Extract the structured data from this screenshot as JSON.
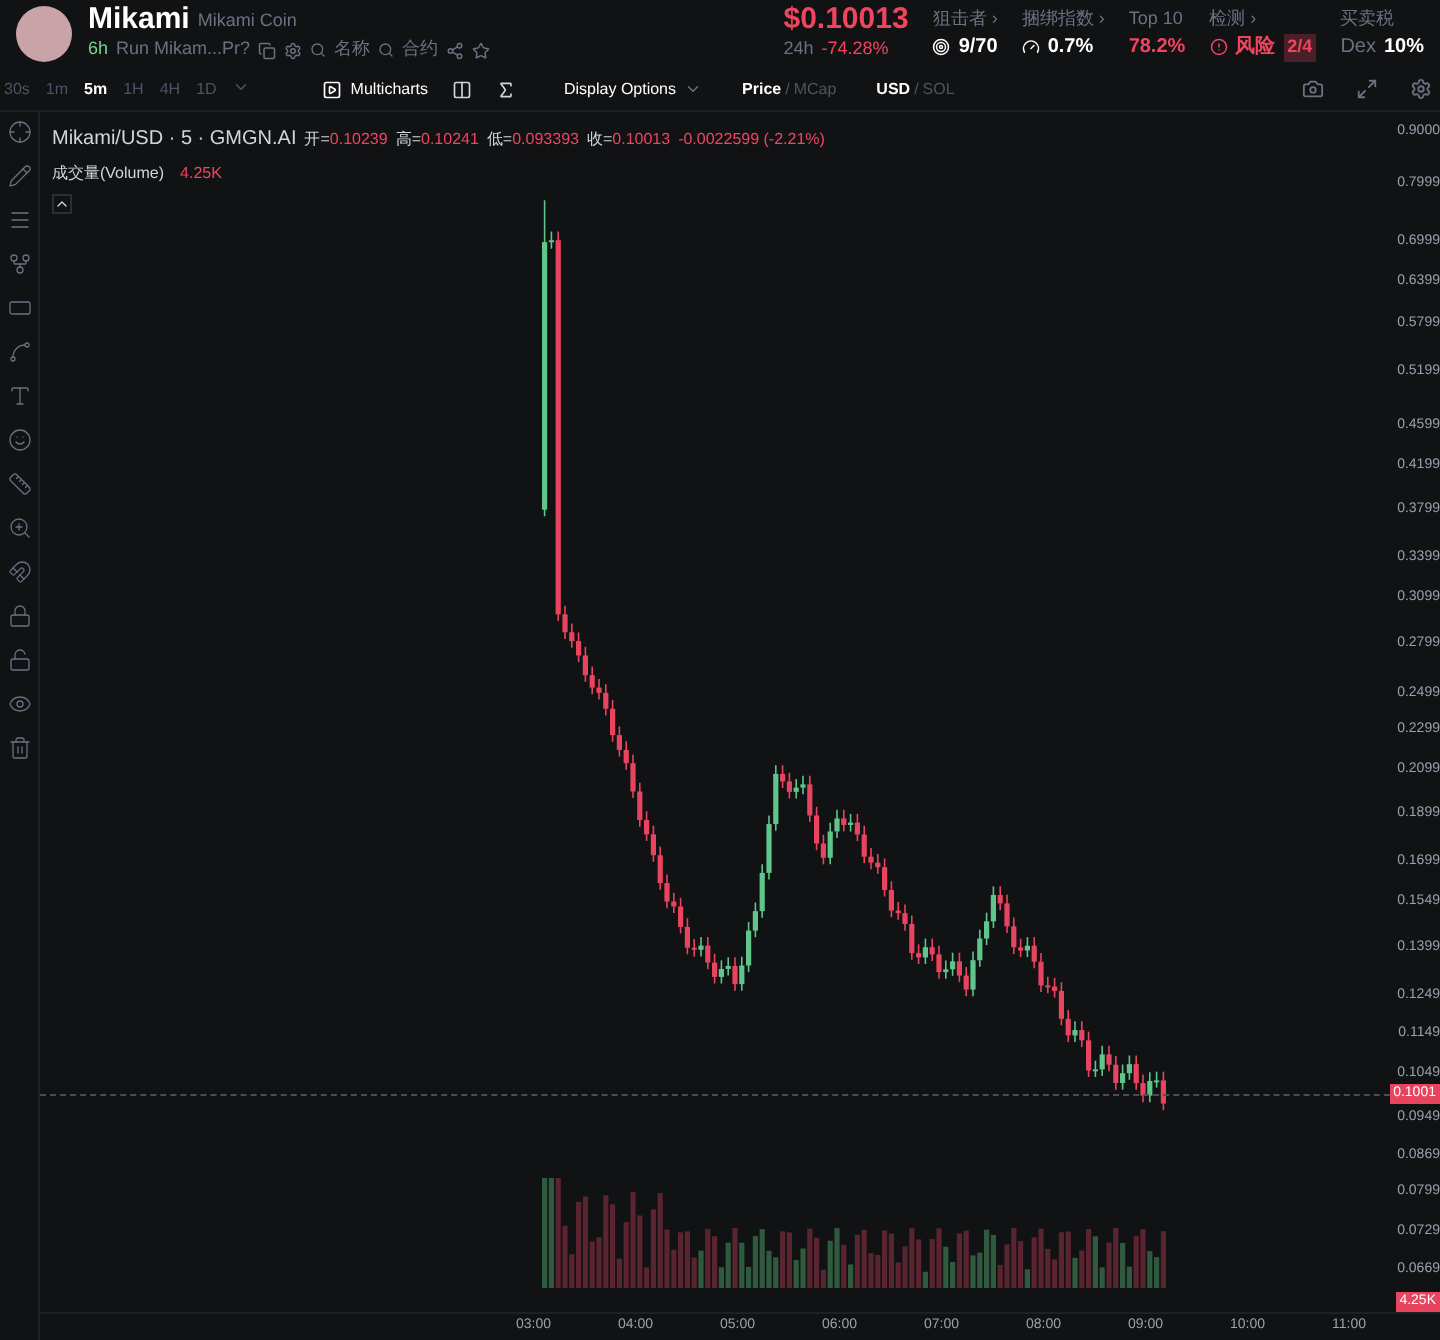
{
  "token": {
    "name": "Mikami",
    "full_name": "Mikami Coin",
    "age": "6h",
    "tag": "Run Mikam...Pr?",
    "search_links": [
      "名称",
      "合约"
    ]
  },
  "price": {
    "value": "$0.10013",
    "period": "24h",
    "change": "-74.28%"
  },
  "stats": [
    {
      "kind": "snipers",
      "label": "狙击者 ›",
      "value": "9/70"
    },
    {
      "kind": "bundle",
      "label": "捆绑指数 ›",
      "value": "0.7%"
    },
    {
      "kind": "top10",
      "label": "Top 10",
      "value": "78.2%"
    },
    {
      "kind": "risk",
      "label": "检测 ›",
      "value": "风险",
      "badge": "2/4"
    },
    {
      "kind": "tax",
      "label": "买卖税",
      "prefix": "Dex",
      "value": "10%"
    }
  ],
  "toolbar": {
    "intervals": [
      {
        "label": "30s",
        "selected": false
      },
      {
        "label": "1m",
        "selected": false
      },
      {
        "label": "5m",
        "selected": true
      },
      {
        "label": "1H",
        "selected": false
      },
      {
        "label": "4H",
        "selected": false
      },
      {
        "label": "1D",
        "selected": false
      }
    ],
    "multicharts": "Multicharts",
    "display_options": "Display Options",
    "separator": "/",
    "price_mode": [
      {
        "label": "Price",
        "selected": true
      },
      {
        "label": "MCap",
        "selected": false
      }
    ],
    "currency": [
      {
        "label": "USD",
        "selected": true
      },
      {
        "label": "SOL",
        "selected": false
      }
    ]
  },
  "legend": {
    "symbol": "Mikami/USD · 5 · GMGN.AI",
    "ohlc": [
      {
        "label": "开=",
        "value": "0.10239"
      },
      {
        "label": "高=",
        "value": "0.10241"
      },
      {
        "label": "低=",
        "value": "0.093393"
      },
      {
        "label": "收=",
        "value": "0.10013"
      }
    ],
    "change": "-0.0022599 (-2.21%)",
    "volume_label": "成交量(Volume)",
    "volume_value": "4.25K"
  },
  "price_axis": [
    "0.9000",
    "0.7999",
    "0.6999",
    "0.6399",
    "0.5799",
    "0.5199",
    "0.4599",
    "0.4199",
    "0.3799",
    "0.3399",
    "0.3099",
    "0.2799",
    "0.2499",
    "0.2299",
    "0.2099",
    "0.1899",
    "0.1699",
    "0.1549",
    "0.1399",
    "0.1249",
    "0.1149",
    "0.1049",
    "0.0949",
    "0.0869",
    "0.0799",
    "0.0729",
    "0.0669"
  ],
  "current_price_tag": "0.1001",
  "volume_tag": "4.25K",
  "time_axis": [
    "03:00",
    "04:00",
    "05:00",
    "06:00",
    "07:00",
    "08:00",
    "09:00",
    "10:00",
    "11:00"
  ]
}
